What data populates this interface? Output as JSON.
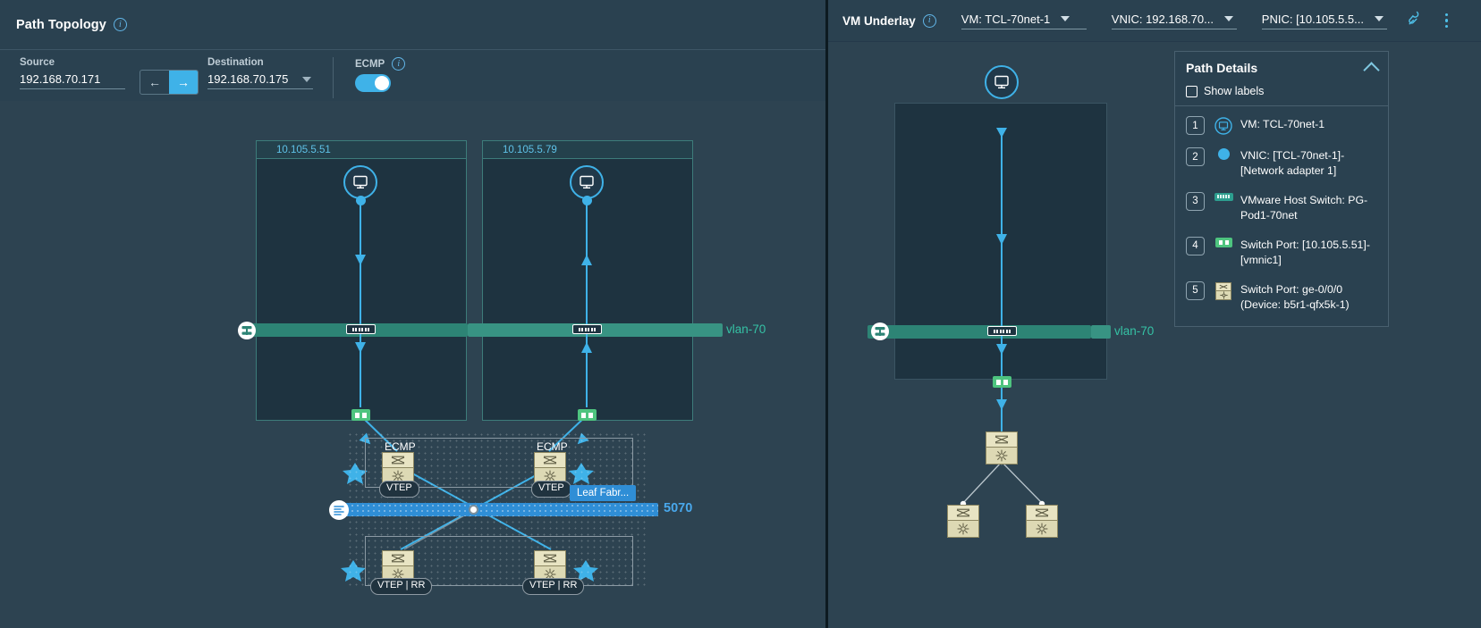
{
  "left": {
    "header": {
      "title": "Path Topology",
      "info_icon": "info-icon"
    },
    "controls": {
      "source_label": "Source",
      "source_value": "192.168.70.171",
      "dir_back_icon": "arrow-left-icon",
      "dir_forward_icon": "arrow-right-icon",
      "destination_label": "Destination",
      "destination_value": "192.168.70.175",
      "ecmp_label": "ECMP",
      "ecmp_enabled": "on"
    },
    "topology": {
      "host_a": "10.105.5.51",
      "host_b": "10.105.5.79",
      "vlan_label": "vlan-70",
      "fabric_label": "5070",
      "ecmp_tag_left": "ECMP",
      "ecmp_tag_right": "ECMP",
      "vtep_left": "VTEP",
      "vtep_right": "VTEP",
      "vtep_rr_left": "VTEP | RR",
      "vtep_rr_right": "VTEP | RR",
      "leaf_fabric_label": "Leaf Fabr..."
    }
  },
  "right": {
    "header": {
      "title": "VM Underlay",
      "info_icon": "info-icon",
      "vm_select": "VM: TCL-70net-1",
      "vnic_select": "VNIC: 192.168.70...",
      "pnic_select": "PNIC: [10.105.5.5...",
      "pin_icon": "pin-icon",
      "kebab_icon": "more-options-icon"
    },
    "topology": {
      "vlan_label": "vlan-70"
    },
    "path_details": {
      "title": "Path Details",
      "collapse_icon": "chevron-up-icon",
      "show_labels_label": "Show labels",
      "show_labels_checked": "false",
      "steps": [
        {
          "num": "1",
          "icon": "vm-monitor-icon",
          "text": "VM: TCL-70net-1"
        },
        {
          "num": "2",
          "icon": "vnic-dot-icon",
          "text": "VNIC: [TCL-70net-1]-[Network adapter 1]"
        },
        {
          "num": "3",
          "icon": "host-switch-icon",
          "text": "VMware Host Switch: PG-Pod1-70net"
        },
        {
          "num": "4",
          "icon": "switch-port-icon",
          "text": "Switch Port: [10.105.5.51]-[vmnic1]"
        },
        {
          "num": "5",
          "icon": "physical-switch-icon",
          "text": "Switch Port: ge-0/0/0 (Device: b5r1-qfx5k-1)"
        }
      ]
    }
  },
  "colors": {
    "accent_blue": "#3fb2e8",
    "vlan_green": "#2d8475",
    "vlan_text": "#35c2a5",
    "fabric_blue": "#2f8ed6",
    "panel_bg": "#2a4150",
    "canvas_bg": "#2d4351",
    "host_bg": "#1e3340",
    "switch_tan": "#e8e4c3",
    "port_green": "#4ec47f"
  }
}
